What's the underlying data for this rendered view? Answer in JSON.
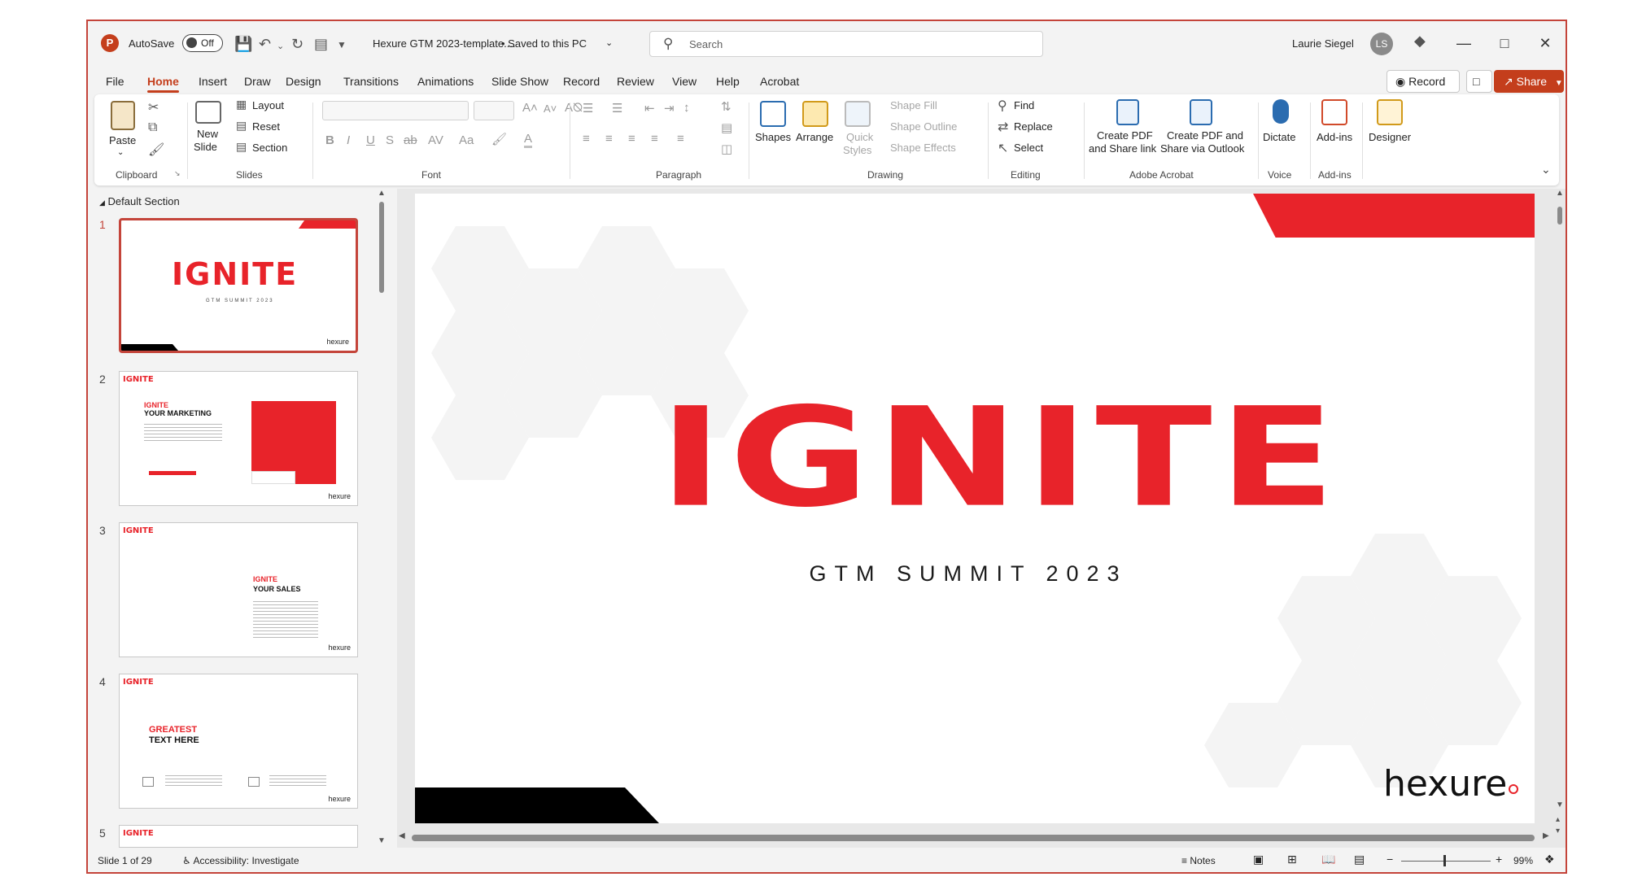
{
  "titlebar": {
    "autosave_label": "AutoSave",
    "autosave_state": "Off",
    "doc_title": "Hexure GTM 2023-template....",
    "saved_status": "• Saved to this PC",
    "search_placeholder": "Search",
    "user_name": "Laurie Siegel",
    "user_initials": "LS"
  },
  "menu": {
    "tabs": [
      "File",
      "Home",
      "Insert",
      "Draw",
      "Design",
      "Transitions",
      "Animations",
      "Slide Show",
      "Record",
      "Review",
      "View",
      "Help",
      "Acrobat"
    ],
    "active_tab": "Home",
    "record_label": "Record",
    "share_label": "Share"
  },
  "ribbon": {
    "clipboard": {
      "paste": "Paste",
      "group": "Clipboard"
    },
    "slides": {
      "new_slide": "New",
      "new_slide2": "Slide",
      "layout": "Layout",
      "reset": "Reset",
      "section": "Section",
      "group": "Slides"
    },
    "font": {
      "group": "Font"
    },
    "paragraph": {
      "group": "Paragraph"
    },
    "drawing": {
      "shapes": "Shapes",
      "arrange": "Arrange",
      "quick_styles": "Quick",
      "quick_styles2": "Styles",
      "shape_fill": "Shape Fill",
      "shape_outline": "Shape Outline",
      "shape_effects": "Shape Effects",
      "group": "Drawing"
    },
    "editing": {
      "find": "Find",
      "replace": "Replace",
      "select": "Select",
      "group": "Editing"
    },
    "acrobat": {
      "create_pdf_link": "Create PDF",
      "create_pdf_link2": "and Share link",
      "create_pdf_outlook": "Create PDF and",
      "create_pdf_outlook2": "Share via Outlook",
      "group": "Adobe Acrobat"
    },
    "voice": {
      "dictate": "Dictate",
      "group": "Voice"
    },
    "addins": {
      "addins": "Add-ins",
      "group": "Add-ins"
    },
    "designer": {
      "designer": "Designer"
    }
  },
  "slide_panel": {
    "section_label": "Default Section",
    "slides": [
      {
        "num": "1",
        "title": "IGNITE",
        "subtitle": "GTM SUMMIT 2023",
        "brand": "hexure"
      },
      {
        "num": "2",
        "title": "IGNITE",
        "heading1": "IGNITE",
        "heading2": "YOUR MARKETING",
        "brand": "hexure"
      },
      {
        "num": "3",
        "title": "IGNITE",
        "heading1": "IGNITE",
        "heading2": "YOUR SALES",
        "brand": "hexure"
      },
      {
        "num": "4",
        "title": "IGNITE",
        "heading1": "GREATEST",
        "heading2": "TEXT HERE",
        "brand": "hexure"
      },
      {
        "num": "5",
        "title": "IGNITE"
      }
    ]
  },
  "main_slide": {
    "title": "IGNITE",
    "subtitle": "GTM SUMMIT 2023",
    "brand": "hexure"
  },
  "status": {
    "slide_counter": "Slide 1 of 29",
    "accessibility": "Accessibility: Investigate",
    "notes": "Notes",
    "zoom": "99%"
  },
  "colors": {
    "accent": "#c43e1c",
    "brand_red": "#e8232a",
    "window_border": "#c4443a"
  }
}
